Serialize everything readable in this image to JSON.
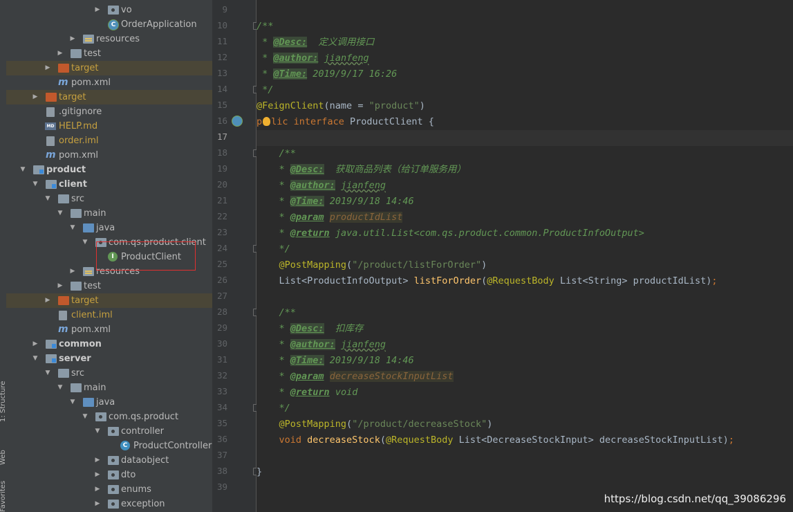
{
  "toolstrip": {
    "structure": "1: Structure",
    "web": "Web",
    "favorites": "Favorites"
  },
  "tree": {
    "items": [
      {
        "label": "vo"
      },
      {
        "label": "OrderApplication"
      },
      {
        "label": "resources"
      },
      {
        "label": "test"
      },
      {
        "label": "target"
      },
      {
        "label": "pom.xml"
      },
      {
        "label": "target"
      },
      {
        "label": ".gitignore"
      },
      {
        "label": "HELP.md"
      },
      {
        "label": "order.iml"
      },
      {
        "label": "pom.xml"
      },
      {
        "label": "product"
      },
      {
        "label": "client"
      },
      {
        "label": "src"
      },
      {
        "label": "main"
      },
      {
        "label": "java"
      },
      {
        "label": "com.qs.product.client"
      },
      {
        "label": "ProductClient"
      },
      {
        "label": "resources"
      },
      {
        "label": "test"
      },
      {
        "label": "target"
      },
      {
        "label": "client.iml"
      },
      {
        "label": "pom.xml"
      },
      {
        "label": "common"
      },
      {
        "label": "server"
      },
      {
        "label": "src"
      },
      {
        "label": "main"
      },
      {
        "label": "java"
      },
      {
        "label": "com.qs.product"
      },
      {
        "label": "controller"
      },
      {
        "label": "ProductController"
      },
      {
        "label": "dataobject"
      },
      {
        "label": "dto"
      },
      {
        "label": "enums"
      },
      {
        "label": "exception"
      }
    ],
    "maven_letter": "m",
    "md_badge": "MD",
    "class_letter": "C",
    "interface_letter": "I"
  },
  "gutter": {
    "line_numbers": [
      "9",
      "10",
      "11",
      "12",
      "13",
      "14",
      "15",
      "16",
      "17",
      "18",
      "19",
      "20",
      "21",
      "22",
      "23",
      "24",
      "25",
      "26",
      "27",
      "28",
      "29",
      "30",
      "31",
      "32",
      "33",
      "34",
      "35",
      "36",
      "37",
      "38",
      "39"
    ]
  },
  "code": {
    "l10": "/**",
    "l11_star": " * ",
    "l11_tag": "@Desc:",
    "l11_text": "  定义调用接口",
    "l12_star": " * ",
    "l12_tag": "@author:",
    "l12_text": "jianfeng",
    "l13_star": " * ",
    "l13_tag": "@Time:",
    "l13_text": " 2019/9/17 16:26",
    "l14": " */",
    "l15_ann": "@FeignClient",
    "l15_a": "(name = ",
    "l15_str": "\"product\"",
    "l15_b": ")",
    "l16_kw1a": "p",
    "l16_kw1b": "lic",
    "l16_kw2": "interface",
    "l16_rest": " ProductClient {",
    "l18": "    /**",
    "l19_star": "    * ",
    "l19_tag": "@Desc:",
    "l19_text": "  获取商品列表（给订单服务用）",
    "l20_star": "    * ",
    "l20_tag": "@author:",
    "l20_text": "jianfeng",
    "l21_star": "    * ",
    "l21_tag": "@Time:",
    "l21_text": " 2019/9/18 14:46",
    "l22_star": "    * ",
    "l22_tag": "@param",
    "l22_text": "productIdList",
    "l23_star": "    * ",
    "l23_tag": "@return",
    "l23_text": " java.util.List<com.qs.product.common.ProductInfoOutput>",
    "l24": "    */",
    "l25_ann": "    @PostMapping",
    "l25_a": "(",
    "l25_str": "\"/product/listForOrder\"",
    "l25_b": ")",
    "l26_a": "    List<ProductInfoOutput> ",
    "l26_fn": "listForOrder",
    "l26_b": "(",
    "l26_ann": "@RequestBody",
    "l26_c": " List<String> productIdList)",
    "l26_semi": ";",
    "l28": "    /**",
    "l29_star": "    * ",
    "l29_tag": "@Desc:",
    "l29_text": "  扣库存",
    "l30_star": "    * ",
    "l30_tag": "@author:",
    "l30_text": "jianfeng",
    "l31_star": "    * ",
    "l31_tag": "@Time:",
    "l31_text": " 2019/9/18 14:46",
    "l32_star": "    * ",
    "l32_tag": "@param",
    "l32_text": "decreaseStockInputList",
    "l33_star": "    * ",
    "l33_tag": "@return",
    "l33_text": " void",
    "l34": "    */",
    "l35_ann": "    @PostMapping",
    "l35_a": "(",
    "l35_str": "\"/product/decreaseStock\"",
    "l35_b": ")",
    "l36_kw": "    void ",
    "l36_fn": "decreaseStock",
    "l36_b": "(",
    "l36_ann": "@RequestBody",
    "l36_c": " List<DecreaseStockInput> decreaseStockInputList)",
    "l36_semi": ";",
    "l38": "}"
  },
  "watermark": "https://blog.csdn.net/qq_39086296"
}
